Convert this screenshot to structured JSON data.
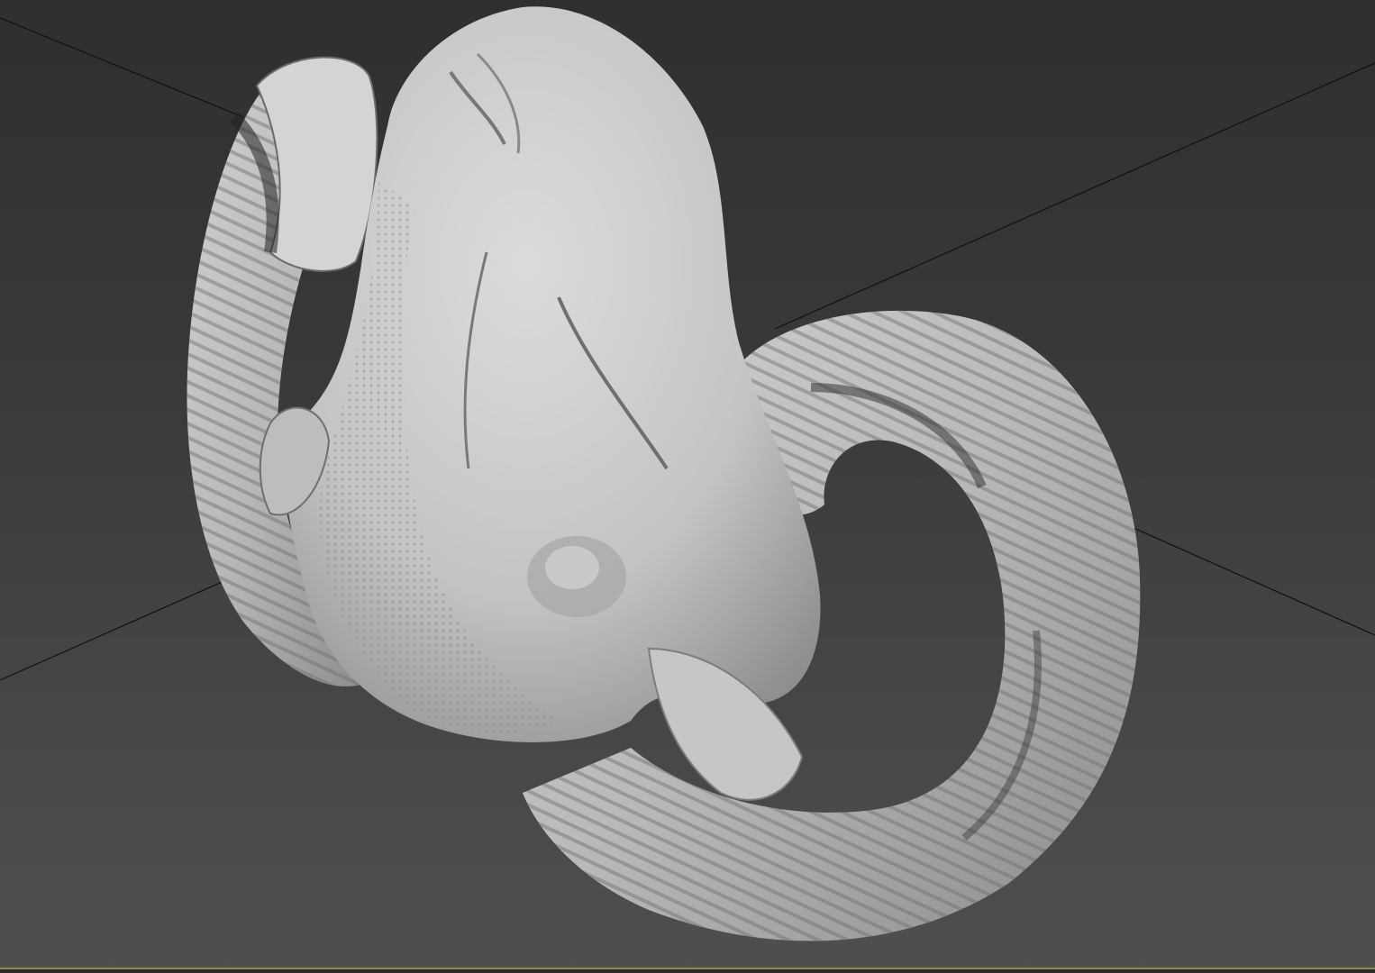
{
  "viewport": {
    "view_mode": "perspective",
    "shading": "clay-gray",
    "background_top": "#2f2f2f",
    "background_bottom": "#4f4f4f",
    "active_border_color": "#8c8a52",
    "model": {
      "icon": "ram-skull-mesh",
      "material_color": "#cfcfcf"
    }
  }
}
